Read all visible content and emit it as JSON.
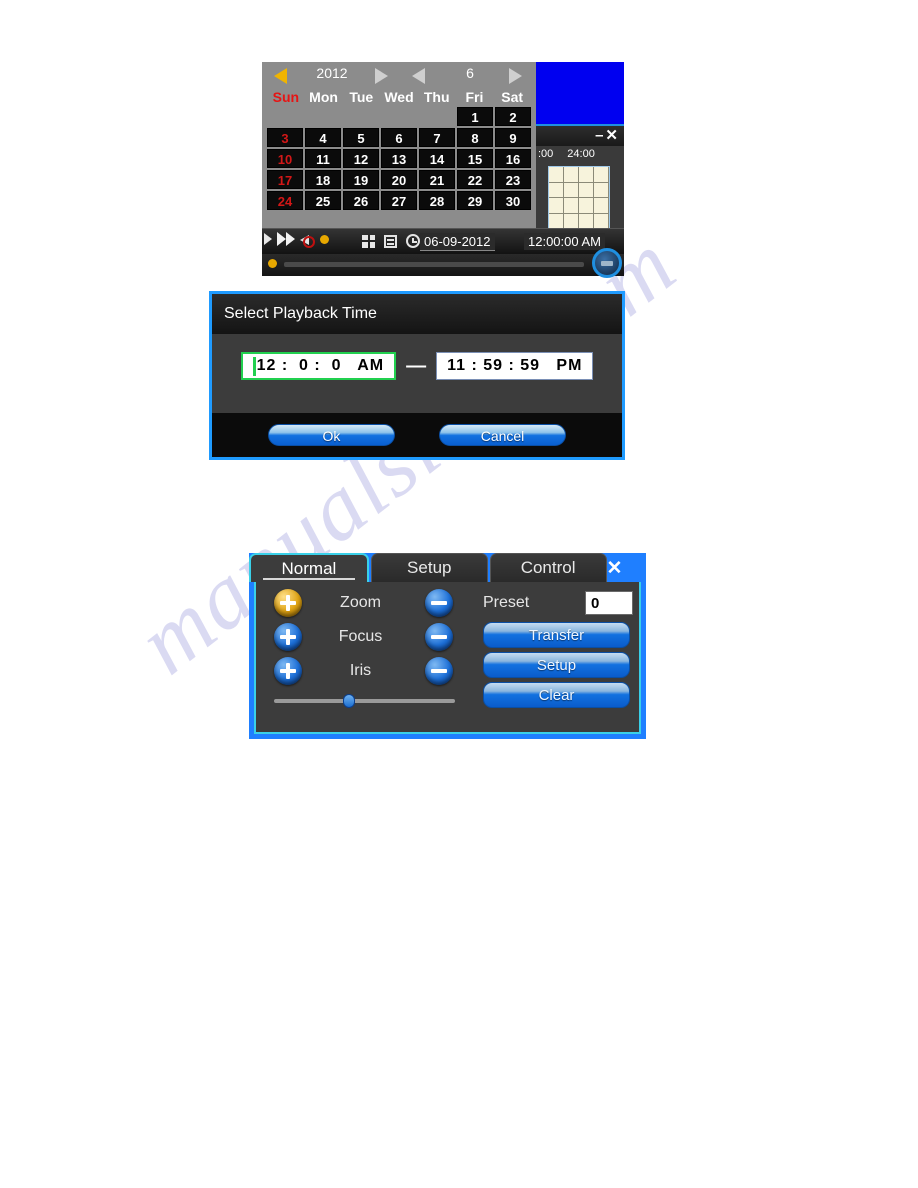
{
  "watermark": {
    "text": "manualslive.com"
  },
  "calendar_figure": {
    "nav": {
      "year": "2012",
      "month": "6",
      "prev_year_icon": "triangle-left-icon",
      "next_year_icon": "triangle-right-icon",
      "prev_month_icon": "triangle-left-icon",
      "next_month_icon": "triangle-right-icon"
    },
    "weekdays": [
      "Sun",
      "Mon",
      "Tue",
      "Wed",
      "Thu",
      "Fri",
      "Sat"
    ],
    "weeks": [
      [
        "",
        "",
        "",
        "",
        "",
        "1",
        "2"
      ],
      [
        "3",
        "4",
        "5",
        "6",
        "7",
        "8",
        "9"
      ],
      [
        "10",
        "11",
        "12",
        "13",
        "14",
        "15",
        "16"
      ],
      [
        "17",
        "18",
        "19",
        "20",
        "21",
        "22",
        "23"
      ],
      [
        "24",
        "25",
        "26",
        "27",
        "28",
        "29",
        "30"
      ]
    ],
    "toolbar": {
      "icons": [
        "play-icon",
        "fast-forward-icon",
        "mute-icon",
        "record-dot-icon",
        "grid-view-icon",
        "list-view-icon",
        "clock-icon"
      ],
      "date": "06-09-2012",
      "time": "12:00:00 AM"
    },
    "mini_window": {
      "minimize_label": "–",
      "close_label": "✕",
      "time_start": ":00",
      "time_end": "24:00"
    }
  },
  "dialog": {
    "title": "Select Playback Time",
    "start_time": "12 :  0 :  0   AM",
    "end_time": "11 : 59 : 59   PM",
    "separator": "—",
    "ok_label": "Ok",
    "cancel_label": "Cancel"
  },
  "ptz": {
    "tabs": [
      {
        "label": "Normal",
        "active": true
      },
      {
        "label": "Setup",
        "active": false
      },
      {
        "label": "Control",
        "active": false
      }
    ],
    "window_buttons": {
      "minimize": "–",
      "close": "✕"
    },
    "controls": [
      {
        "label": "Zoom",
        "plus_icon": "plus-circle-icon",
        "minus_icon": "minus-circle-icon",
        "plus_highlighted": true
      },
      {
        "label": "Focus",
        "plus_icon": "plus-circle-icon",
        "minus_icon": "minus-circle-icon",
        "plus_highlighted": false
      },
      {
        "label": "Iris",
        "plus_icon": "plus-circle-icon",
        "minus_icon": "minus-circle-icon",
        "plus_highlighted": false
      }
    ],
    "speed_slider": {
      "value_percent": 38
    },
    "preset_label": "Preset",
    "preset_value": "0",
    "buttons": [
      "Transfer",
      "Setup",
      "Clear"
    ]
  },
  "colors": {
    "accent_blue": "#1f9bff",
    "tab_cyan": "#3ad0e8",
    "highlight_gold": "#e0a313",
    "sunday_red": "#e61414",
    "panel_gray": "#8c8c8c",
    "body_gray": "#3c3c3c",
    "video_blue": "#0000f0"
  }
}
